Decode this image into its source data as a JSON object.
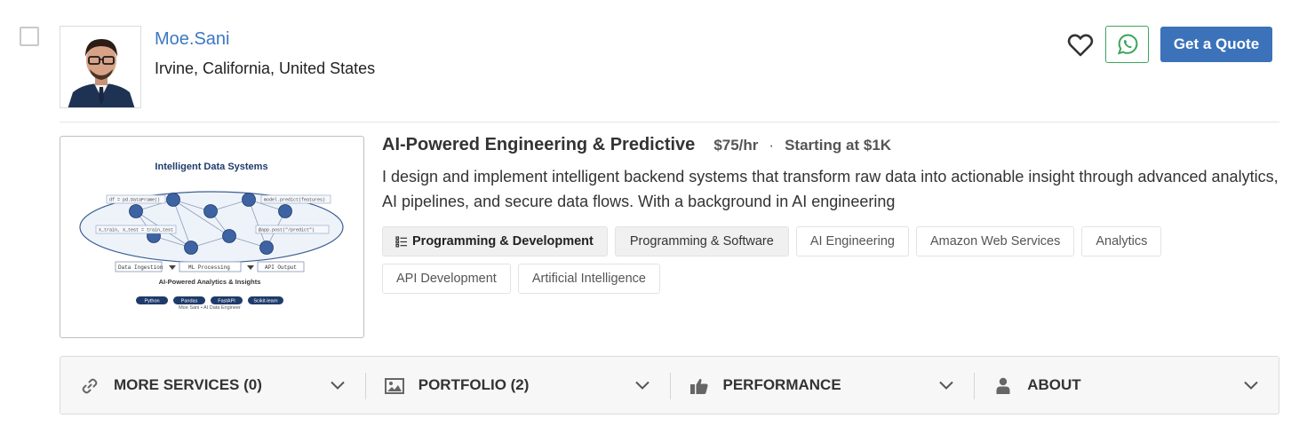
{
  "profile": {
    "name": "Moe.Sani",
    "location": "Irvine, California, United States"
  },
  "actions": {
    "favorite_icon": "heart-icon",
    "whatsapp_icon": "whatsapp-icon",
    "quote_label": "Get a Quote",
    "whatsapp_color": "#3ca55c",
    "quote_color": "#3b72b9"
  },
  "service": {
    "title": "AI-Powered Engineering & Predictive",
    "rate": "$75/hr",
    "separator": "·",
    "starting": "Starting at $1K",
    "description": "I design and implement intelligent backend systems that transform raw data into actionable insight through advanced analytics, AI pipelines, and secure data flows. With a background in AI engineering",
    "thumbnail": {
      "title": "Intelligent Data Systems",
      "code_top_left": "df = pd.DataFrame()",
      "code_top_right": "model.predict(features)",
      "code_mid_left": "X_train, X_test = train_test",
      "code_mid_right": "@app.post(\"/predict\")",
      "box_left": "Data Ingestion",
      "box_mid": "ML Processing",
      "box_right": "API Output",
      "subtitle": "AI-Powered Analytics & Insights",
      "pills": [
        "Python",
        "Pandas",
        "FastAPI",
        "Scikit-learn"
      ],
      "footer": "Moe Sani • AI Data Engineer"
    }
  },
  "tags": [
    "Programming & Development",
    "Programming & Software",
    "AI Engineering",
    "Amazon Web Services",
    "Analytics",
    "API Development",
    "Artificial Intelligence"
  ],
  "accordion": [
    {
      "label": "MORE SERVICES (0)",
      "icon": "link-icon"
    },
    {
      "label": "PORTFOLIO (2)",
      "icon": "image-icon"
    },
    {
      "label": "PERFORMANCE",
      "icon": "thumbs-up-icon"
    },
    {
      "label": "ABOUT",
      "icon": "user-icon"
    }
  ]
}
